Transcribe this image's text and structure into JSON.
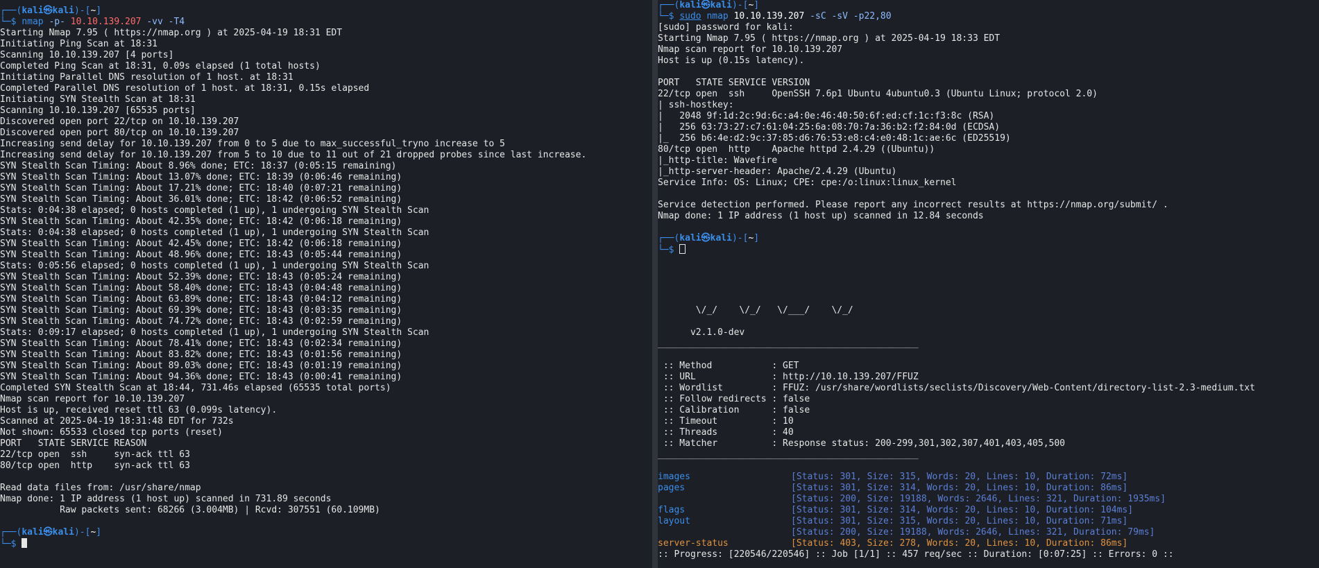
{
  "left": {
    "prompt_user": "kali",
    "prompt_host": "kali",
    "prompt_dir": "~",
    "command": {
      "bin": "nmap",
      "flag1": "-p-",
      "target": "10.10.139.207",
      "flag2": "-vv",
      "flag3": "-T4"
    },
    "output": [
      "Starting Nmap 7.95 ( https://nmap.org ) at 2025-04-19 18:31 EDT",
      "Initiating Ping Scan at 18:31",
      "Scanning 10.10.139.207 [4 ports]",
      "Completed Ping Scan at 18:31, 0.09s elapsed (1 total hosts)",
      "Initiating Parallel DNS resolution of 1 host. at 18:31",
      "Completed Parallel DNS resolution of 1 host. at 18:31, 0.15s elapsed",
      "Initiating SYN Stealth Scan at 18:31",
      "Scanning 10.10.139.207 [65535 ports]",
      "Discovered open port 22/tcp on 10.10.139.207",
      "Discovered open port 80/tcp on 10.10.139.207",
      "Increasing send delay for 10.10.139.207 from 0 to 5 due to max_successful_tryno increase to 5",
      "Increasing send delay for 10.10.139.207 from 5 to 10 due to 11 out of 21 dropped probes since last increase.",
      "SYN Stealth Scan Timing: About 8.96% done; ETC: 18:37 (0:05:15 remaining)",
      "SYN Stealth Scan Timing: About 13.07% done; ETC: 18:39 (0:06:46 remaining)",
      "SYN Stealth Scan Timing: About 17.21% done; ETC: 18:40 (0:07:21 remaining)",
      "SYN Stealth Scan Timing: About 36.01% done; ETC: 18:42 (0:06:52 remaining)",
      "Stats: 0:04:38 elapsed; 0 hosts completed (1 up), 1 undergoing SYN Stealth Scan",
      "SYN Stealth Scan Timing: About 42.35% done; ETC: 18:42 (0:06:18 remaining)",
      "Stats: 0:04:38 elapsed; 0 hosts completed (1 up), 1 undergoing SYN Stealth Scan",
      "SYN Stealth Scan Timing: About 42.45% done; ETC: 18:42 (0:06:18 remaining)",
      "SYN Stealth Scan Timing: About 48.96% done; ETC: 18:43 (0:05:44 remaining)",
      "Stats: 0:05:56 elapsed; 0 hosts completed (1 up), 1 undergoing SYN Stealth Scan",
      "SYN Stealth Scan Timing: About 52.39% done; ETC: 18:43 (0:05:24 remaining)",
      "SYN Stealth Scan Timing: About 58.40% done; ETC: 18:43 (0:04:48 remaining)",
      "SYN Stealth Scan Timing: About 63.89% done; ETC: 18:43 (0:04:12 remaining)",
      "SYN Stealth Scan Timing: About 69.39% done; ETC: 18:43 (0:03:35 remaining)",
      "SYN Stealth Scan Timing: About 74.72% done; ETC: 18:43 (0:02:59 remaining)",
      "Stats: 0:09:17 elapsed; 0 hosts completed (1 up), 1 undergoing SYN Stealth Scan",
      "SYN Stealth Scan Timing: About 78.41% done; ETC: 18:43 (0:02:34 remaining)",
      "SYN Stealth Scan Timing: About 83.82% done; ETC: 18:43 (0:01:56 remaining)",
      "SYN Stealth Scan Timing: About 89.03% done; ETC: 18:43 (0:01:19 remaining)",
      "SYN Stealth Scan Timing: About 94.36% done; ETC: 18:43 (0:00:41 remaining)",
      "Completed SYN Stealth Scan at 18:44, 731.46s elapsed (65535 total ports)",
      "Nmap scan report for 10.10.139.207",
      "Host is up, received reset ttl 63 (0.099s latency).",
      "Scanned at 2025-04-19 18:31:48 EDT for 732s",
      "Not shown: 65533 closed tcp ports (reset)",
      "PORT   STATE SERVICE REASON",
      "22/tcp open  ssh     syn-ack ttl 63",
      "80/tcp open  http    syn-ack ttl 63",
      "",
      "Read data files from: /usr/share/nmap",
      "Nmap done: 1 IP address (1 host up) scanned in 731.89 seconds",
      "           Raw packets sent: 68266 (3.004MB) | Rcvd: 307551 (60.109MB)"
    ]
  },
  "right": {
    "prompt_user": "kali",
    "prompt_host": "kali",
    "prompt_dir": "~",
    "command": {
      "sudo": "sudo",
      "bin": "nmap",
      "target": "10.10.139.207",
      "flags": "-sC -sV -p22,80"
    },
    "nmap_output": [
      "[sudo] password for kali:",
      "Starting Nmap 7.95 ( https://nmap.org ) at 2025-04-19 18:33 EDT",
      "Nmap scan report for 10.10.139.207",
      "Host is up (0.15s latency).",
      "",
      "PORT   STATE SERVICE VERSION",
      "22/tcp open  ssh     OpenSSH 7.6p1 Ubuntu 4ubuntu0.3 (Ubuntu Linux; protocol 2.0)",
      "| ssh-hostkey:",
      "|   2048 9f:1d:2c:9d:6c:a4:0e:46:40:50:6f:ed:cf:1c:f3:8c (RSA)",
      "|   256 63:73:27:c7:61:04:25:6a:08:70:7a:36:b2:f2:84:0d (ECDSA)",
      "|_  256 b6:4e:d2:9c:37:85:d6:76:53:e8:c4:e0:48:1c:ae:6c (ED25519)",
      "80/tcp open  http    Apache httpd 2.4.29 ((Ubuntu))",
      "|_http-title: Wavefire",
      "|_http-server-header: Apache/2.4.29 (Ubuntu)",
      "Service Info: OS: Linux; CPE: cpe:/o:linux:linux_kernel",
      "",
      "Service detection performed. Please report any incorrect results at https://nmap.org/submit/ .",
      "Nmap done: 1 IP address (1 host up) scanned in 12.84 seconds"
    ],
    "ffuf_art": [
      "       \\/_/    \\/_/   \\/___/    \\/_/",
      "",
      "      v2.1.0-dev"
    ],
    "separator": "________________________________________________",
    "ffuf_options": [
      " :: Method           : GET",
      " :: URL              : http://10.10.139.207/FFUZ",
      " :: Wordlist         : FFUZ: /usr/share/wordlists/seclists/Discovery/Web-Content/directory-list-2.3-medium.txt",
      " :: Follow redirects : false",
      " :: Calibration      : false",
      " :: Timeout          : 10",
      " :: Threads          : 40",
      " :: Matcher          : Response status: 200-299,301,302,307,401,403,405,500"
    ],
    "results": [
      {
        "name": "images",
        "status": "[Status: 301, Size: 315, Words: 20, Lines: 10, Duration: 72ms]"
      },
      {
        "name": "pages",
        "status": "[Status: 301, Size: 314, Words: 20, Lines: 10, Duration: 86ms]"
      },
      {
        "name": "",
        "status": "[Status: 200, Size: 19188, Words: 2646, Lines: 321, Duration: 1935ms]"
      },
      {
        "name": "flags",
        "status": "[Status: 301, Size: 314, Words: 20, Lines: 10, Duration: 104ms]"
      },
      {
        "name": "layout",
        "status": "[Status: 301, Size: 315, Words: 20, Lines: 10, Duration: 71ms]"
      },
      {
        "name": "",
        "status": "[Status: 200, Size: 19188, Words: 2646, Lines: 321, Duration: 79ms]"
      },
      {
        "name": "server-status",
        "status": "[Status: 403, Size: 278, Words: 20, Lines: 10, Duration: 86ms]"
      }
    ],
    "progress": ":: Progress: [220546/220546] :: Job [1/1] :: 457 req/sec :: Duration: [0:07:25] :: Errors: 0 ::"
  },
  "colors": {
    "prompt": "#3b8eea",
    "target": "#ff6b6b",
    "status": "#5b7fd6",
    "server_status": "#e0923e",
    "background": "#1c1f26"
  }
}
